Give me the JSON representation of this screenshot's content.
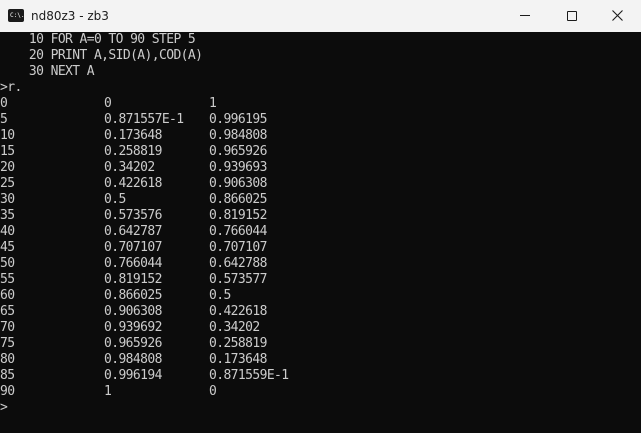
{
  "window": {
    "title": "nd80z3 - zb3",
    "icon": "terminal-icon",
    "icon_text": "C:\\."
  },
  "console": {
    "program": [
      "    10 FOR A=0 TO 90 STEP 5",
      "    20 PRINT A,SID(A),COD(A)",
      "    30 NEXT A"
    ],
    "prompt_line": ">r.",
    "rows": [
      [
        "0",
        "0",
        "1"
      ],
      [
        "5",
        "0.871557E-1",
        "0.996195"
      ],
      [
        "10",
        "0.173648",
        "0.984808"
      ],
      [
        "15",
        "0.258819",
        "0.965926"
      ],
      [
        "20",
        "0.34202",
        "0.939693"
      ],
      [
        "25",
        "0.422618",
        "0.906308"
      ],
      [
        "30",
        "0.5",
        "0.866025"
      ],
      [
        "35",
        "0.573576",
        "0.819152"
      ],
      [
        "40",
        "0.642787",
        "0.766044"
      ],
      [
        "45",
        "0.707107",
        "0.707107"
      ],
      [
        "50",
        "0.766044",
        "0.642788"
      ],
      [
        "55",
        "0.819152",
        "0.573577"
      ],
      [
        "60",
        "0.866025",
        "0.5"
      ],
      [
        "65",
        "0.906308",
        "0.422618"
      ],
      [
        "70",
        "0.939692",
        "0.34202"
      ],
      [
        "75",
        "0.965926",
        "0.258819"
      ],
      [
        "80",
        "0.984808",
        "0.173648"
      ],
      [
        "85",
        "0.996194",
        "0.871559E-1"
      ],
      [
        "90",
        "1",
        "0"
      ]
    ],
    "final_prompt": ">"
  },
  "colors": {
    "console_background": "#0c0c0c",
    "console_text": "#cccccc",
    "titlebar_background": "#f3f3f3"
  }
}
